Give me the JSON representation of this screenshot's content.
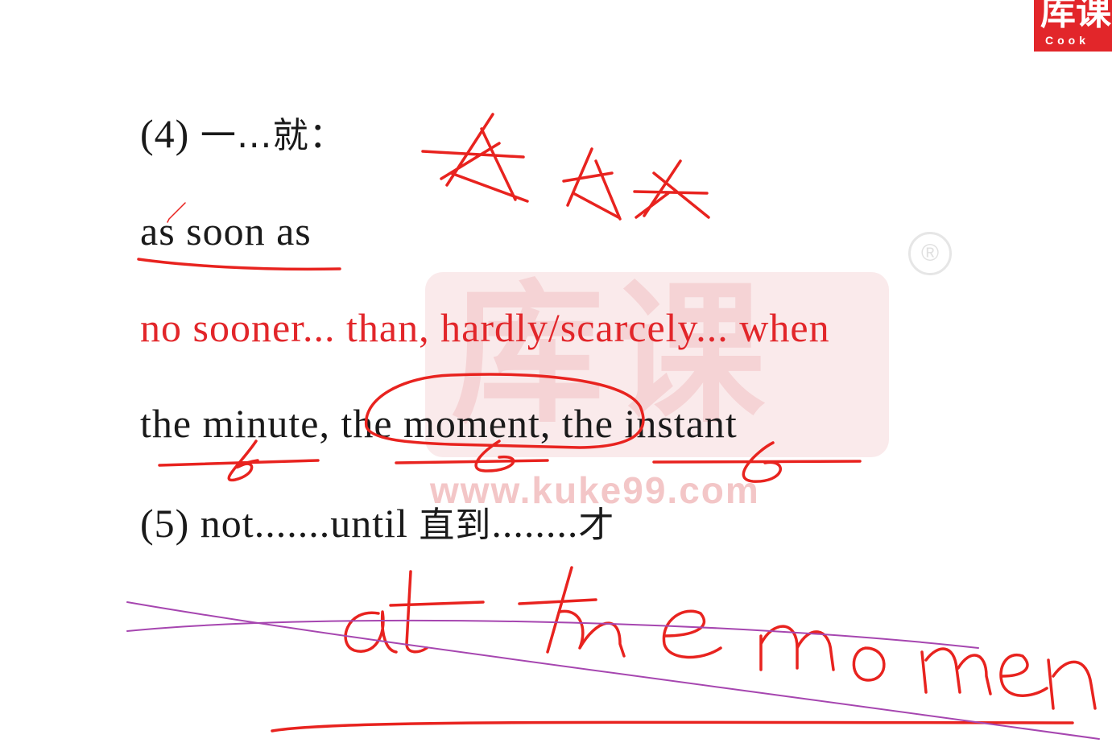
{
  "lines": {
    "item4_num": "(4)",
    "item4_cn": "一…就：",
    "as_soon_as": "as soon as",
    "no_sooner": "no sooner... than, hardly/scarcely... when",
    "minute": "the minute, the moment, the instant",
    "item5_en": "(5) not.......until ",
    "item5_cn1": "直到",
    "item5_dots": "........",
    "item5_cn2": "才"
  },
  "handwriting": {
    "phrase": "at the moment",
    "strikes": "x x x"
  },
  "watermark": {
    "brand_cn": "库课",
    "site": "www.kuke99.com",
    "registered": "®"
  },
  "logo": {
    "cn": "库课",
    "en": "Cook"
  },
  "colors": {
    "red_text": "#e2262a",
    "ink_red": "#e8231f",
    "ink_purple": "#a646b0"
  }
}
